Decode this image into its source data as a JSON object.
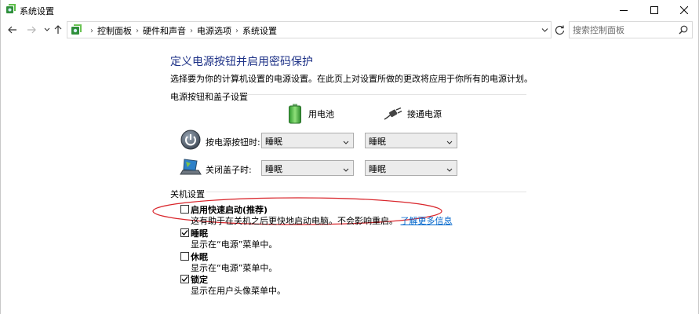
{
  "window": {
    "title": "系统设置"
  },
  "address": {
    "crumbs": [
      "控制面板",
      "硬件和声音",
      "电源选项",
      "系统设置"
    ]
  },
  "search": {
    "placeholder": "搜索控制面板"
  },
  "page": {
    "heading": "定义电源按钮并启用密码保护",
    "description": "选择要为你的计算机设置的电源设置。在此页上对设置所做的更改将应用于你所有的电源计划。"
  },
  "power_section": {
    "title": "电源按钮和盖子设置",
    "col_battery": "用电池",
    "col_plugged": "接通电源",
    "rows": [
      {
        "label": "按电源按钮时:",
        "battery": "睡眠",
        "plugged": "睡眠"
      },
      {
        "label": "关闭盖子时:",
        "battery": "睡眠",
        "plugged": "睡眠"
      }
    ]
  },
  "shutdown_section": {
    "title": "关机设置",
    "options": [
      {
        "label": "启用快速启动(推荐)",
        "desc": "这有助于在关机之后更快地启动电脑。不会影响重启。",
        "link": "了解更多信息",
        "checked": false
      },
      {
        "label": "睡眠",
        "desc": "显示在“电源”菜单中。",
        "checked": true
      },
      {
        "label": "休眠",
        "desc": "显示在“电源”菜单中。",
        "checked": false
      },
      {
        "label": "锁定",
        "desc": "显示在用户头像菜单中。",
        "checked": true
      }
    ]
  },
  "colors": {
    "heading": "#1e3287",
    "link": "#0066cc",
    "highlight_ellipse": "#d9262c"
  }
}
